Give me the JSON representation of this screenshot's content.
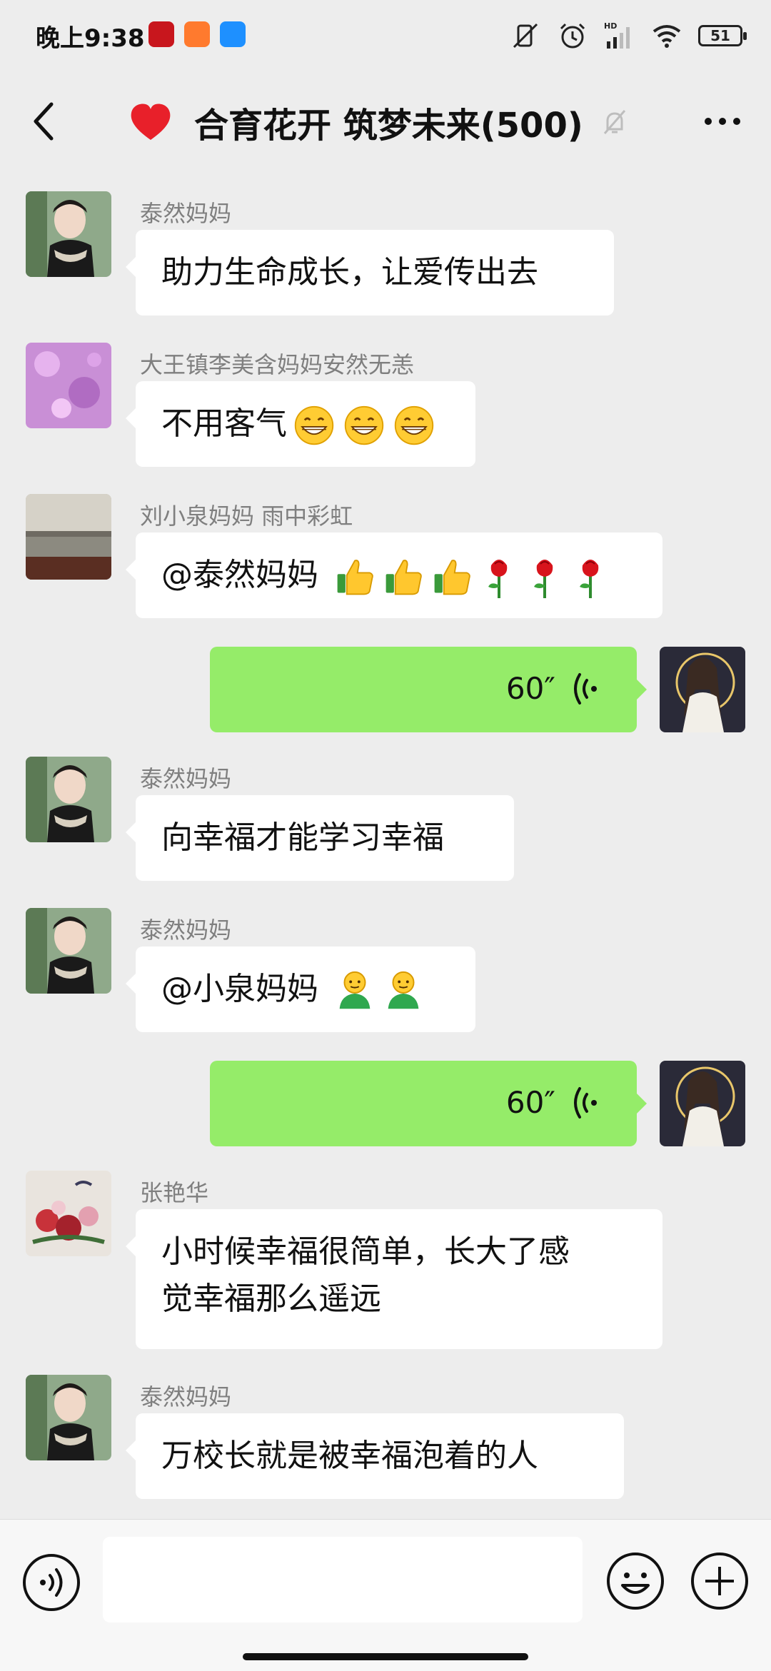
{
  "status_bar": {
    "time": "晚上9:38",
    "battery": "51"
  },
  "header": {
    "title": "合育花开 筑梦未来(500)"
  },
  "messages": [
    {
      "sender": "泰然妈妈",
      "text": "助力生命成长，让爱传出去"
    },
    {
      "sender": "大王镇李美含妈妈安然无恙",
      "text": "不用客气"
    },
    {
      "sender": "刘小泉妈妈  雨中彩虹",
      "text": "@泰然妈妈 "
    },
    {
      "duration": "60″"
    },
    {
      "sender": "泰然妈妈",
      "text": "向幸福才能学习幸福"
    },
    {
      "sender": "泰然妈妈",
      "text": "@小泉妈妈 "
    },
    {
      "duration": "60″"
    },
    {
      "sender": "张艳华",
      "text_line1": "小时候幸福很简单，长大了感",
      "text_line2": "觉幸福那么遥远"
    },
    {
      "sender": "泰然妈妈",
      "text": "万校长就是被幸福泡着的人"
    }
  ],
  "colors": {
    "background": "#ededed",
    "outgoing_bubble": "#95ec69",
    "incoming_bubble": "#ffffff",
    "heart": "#e8202a"
  },
  "icons": [
    "back-icon",
    "heart-icon",
    "mute-bell-icon",
    "more-icon",
    "voice-wave-icon",
    "grin-emoji-icon",
    "thumbs-up-icon",
    "rose-icon",
    "person-emoji-icon",
    "voice-input-icon",
    "smile-icon",
    "plus-icon"
  ]
}
